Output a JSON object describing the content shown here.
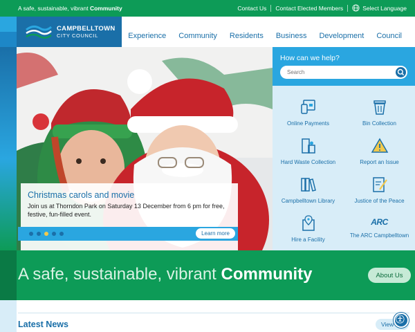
{
  "topbar": {
    "tagline_prefix": "A safe, sustainable, vibrant",
    "tagline_bold": "Community",
    "links": [
      "Contact Us",
      "Contact Elected Members"
    ],
    "language_label": "Select Language"
  },
  "logo": {
    "line1": "CAMPBELLTOWN",
    "line2": "CITY COUNCIL"
  },
  "nav": [
    "Experience",
    "Community",
    "Residents",
    "Business",
    "Development",
    "Council"
  ],
  "hero": {
    "title": "Christmas carols and movie",
    "body": "Join us at Thorndon Park on Saturday 13 December from 6 pm for free, festive, fun-filled event.",
    "cta": "Learn more",
    "slide_count": 5,
    "active_slide": 3
  },
  "help": {
    "heading": "How can we help?",
    "search_placeholder": "Search",
    "tiles": [
      {
        "label": "Online Payments",
        "icon": "online-payments-icon"
      },
      {
        "label": "Bin Collection",
        "icon": "bin-icon"
      },
      {
        "label": "Hard Waste Collection",
        "icon": "hard-waste-icon"
      },
      {
        "label": "Report an Issue",
        "icon": "warning-icon"
      },
      {
        "label": "Campbelltown Library",
        "icon": "library-icon"
      },
      {
        "label": "Justice of the Peace",
        "icon": "document-pen-icon"
      },
      {
        "label": "Hire a Facility",
        "icon": "location-doc-icon"
      },
      {
        "label": "The ARC Campbelltown",
        "icon": "arc-logo-icon",
        "mark": "ARC"
      }
    ]
  },
  "band": {
    "slogan_prefix": "A safe, sustainable, vibrant",
    "slogan_bold": "Community",
    "button": "About Us"
  },
  "news": {
    "heading": "Latest News",
    "button": "View"
  },
  "colors": {
    "green": "#0d9b57",
    "blue": "#1a6fa8",
    "light_blue": "#2aa6e0",
    "pale_blue": "#d8edf8"
  }
}
